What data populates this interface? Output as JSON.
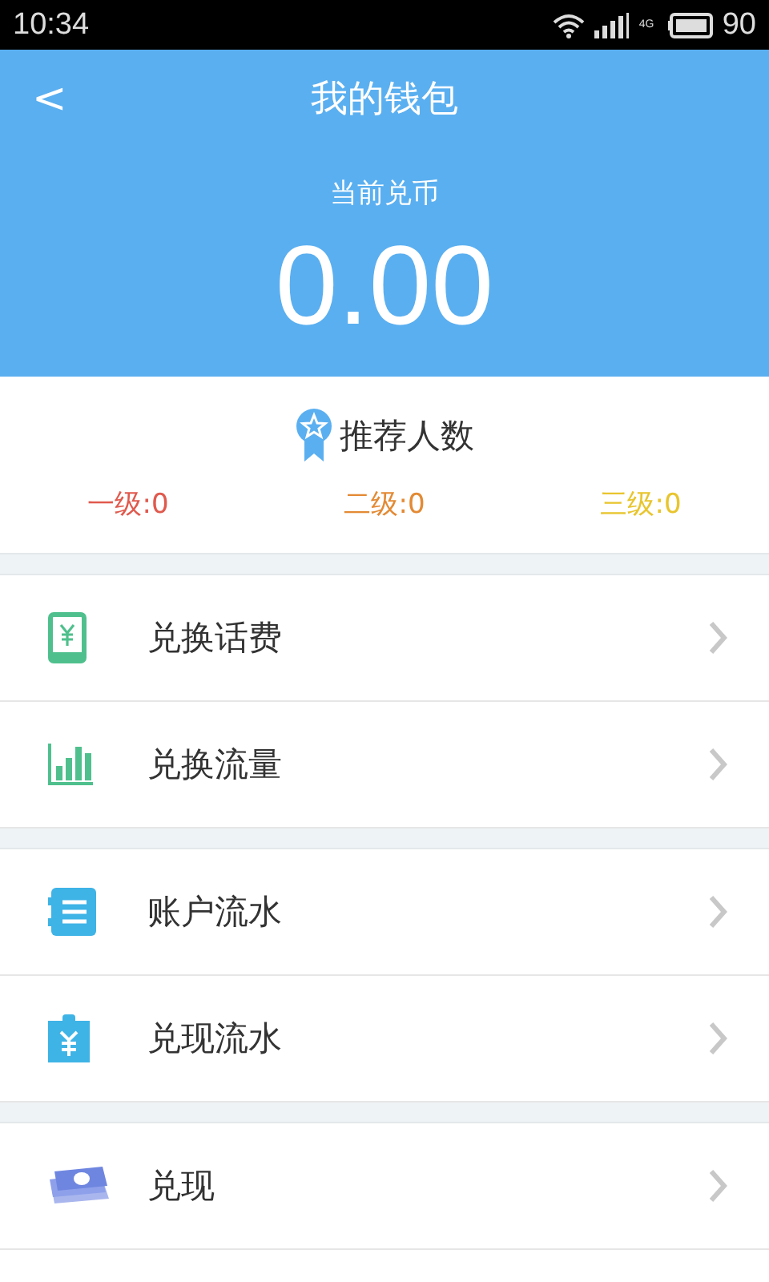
{
  "status_bar": {
    "time": "10:34",
    "network": "4G",
    "battery": "90"
  },
  "header": {
    "back": "<",
    "title": "我的钱包",
    "balance_label": "当前兑币",
    "balance": "0.00"
  },
  "referrals": {
    "title": "推荐人数",
    "levels": [
      {
        "label": "一级:0",
        "color": "#e05a4e"
      },
      {
        "label": "二级:0",
        "color": "#e38a34"
      },
      {
        "label": "三级:0",
        "color": "#e8c52e"
      }
    ]
  },
  "menu_groups": [
    {
      "items": [
        {
          "label": "兑换话费"
        },
        {
          "label": "兑换流量"
        }
      ]
    },
    {
      "items": [
        {
          "label": "账户流水"
        },
        {
          "label": "兑现流水"
        }
      ]
    },
    {
      "items": [
        {
          "label": "兑现"
        }
      ]
    }
  ]
}
